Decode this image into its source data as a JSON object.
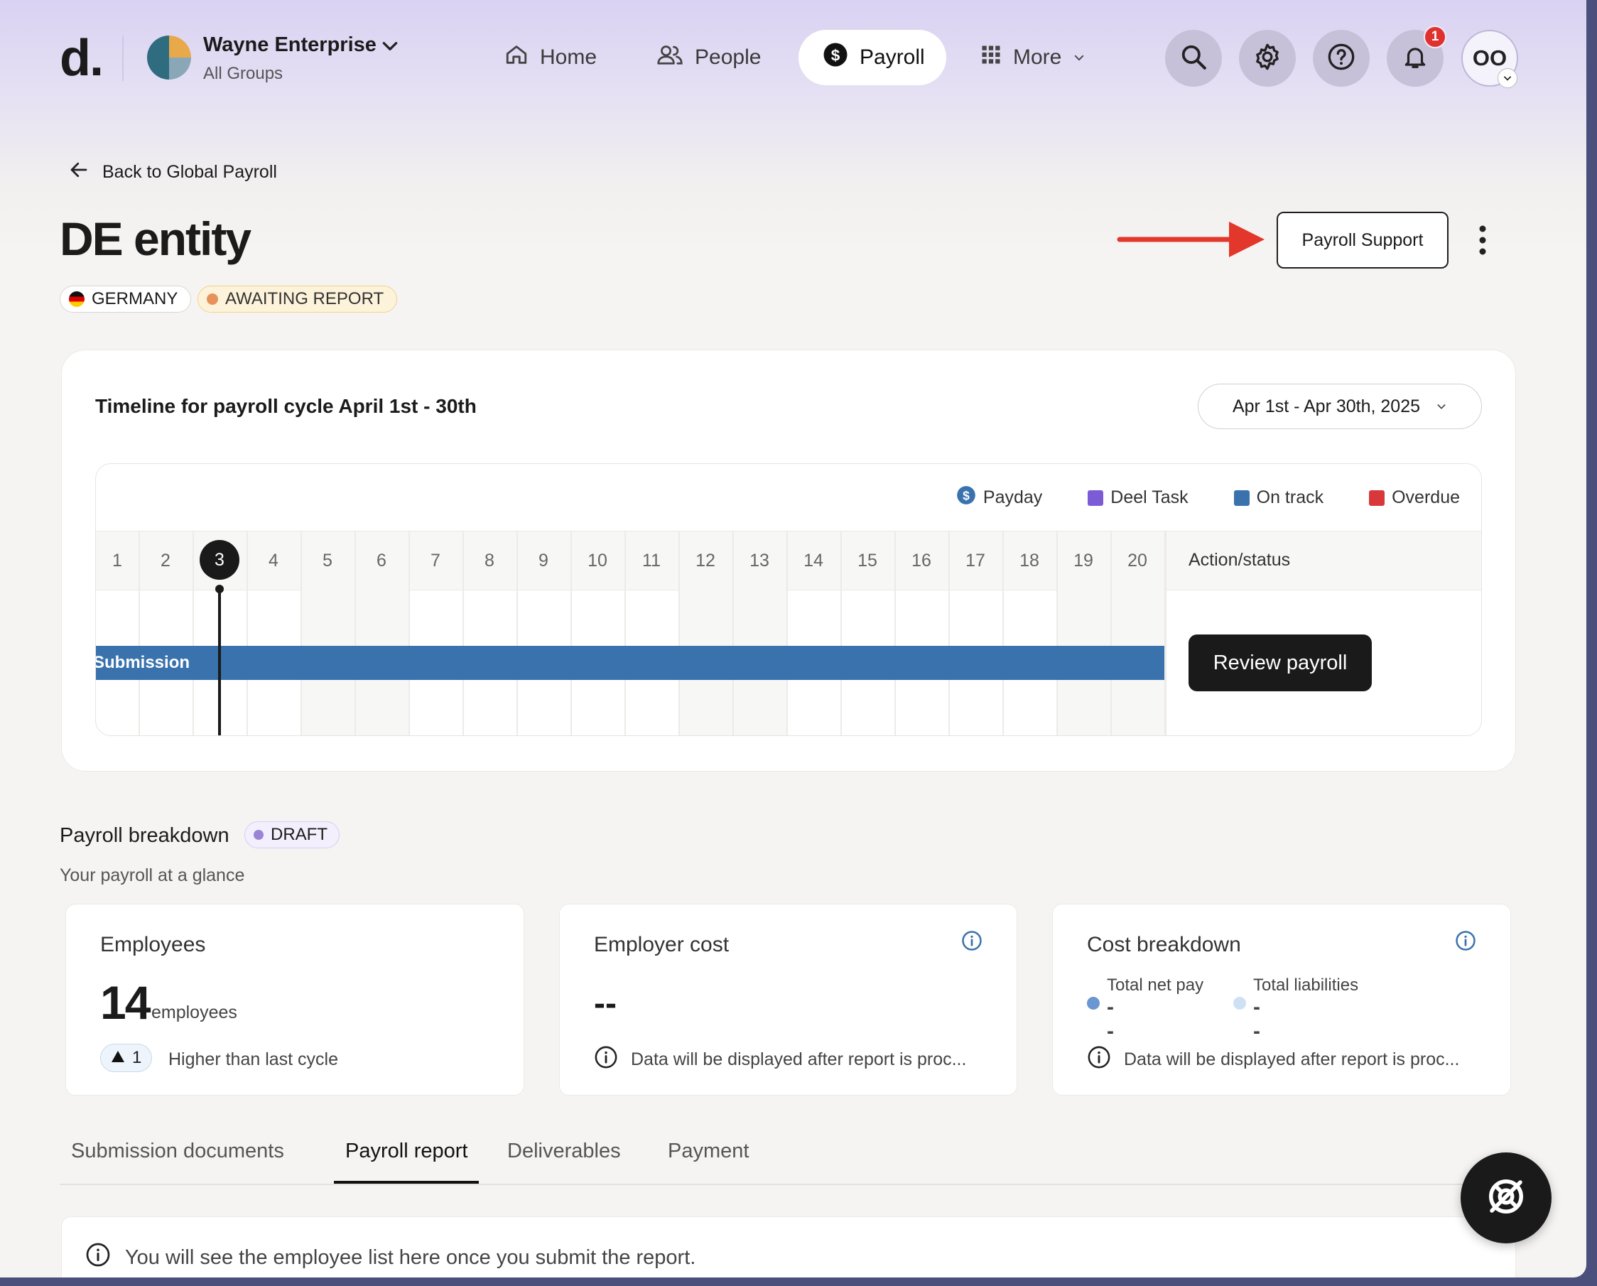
{
  "nav": {
    "logo": "d.",
    "org_name": "Wayne Enterprise",
    "org_group": "All Groups",
    "items": [
      {
        "label": "Home",
        "icon": "home-icon"
      },
      {
        "label": "People",
        "icon": "people-icon"
      },
      {
        "label": "Payroll",
        "icon": "dollar-icon",
        "active": true
      },
      {
        "label": "More",
        "icon": "grid-icon"
      }
    ],
    "notification_count": "1",
    "user_initials": "OO"
  },
  "header": {
    "back_label": "Back to Global Payroll",
    "title": "DE entity",
    "country_chip": "GERMANY",
    "status_chip": "AWAITING REPORT",
    "support_button": "Payroll Support"
  },
  "timeline": {
    "title": "Timeline for payroll cycle April 1st - 30th",
    "date_range": "Apr 1st - Apr 30th, 2025",
    "legend": [
      {
        "label": "Payday",
        "color": "#3a72ad"
      },
      {
        "label": "Deel Task",
        "color": "#7c5cd6"
      },
      {
        "label": "On track",
        "color": "#3a72ad"
      },
      {
        "label": "Overdue",
        "color": "#d9383a"
      }
    ],
    "days": [
      "1",
      "2",
      "3",
      "4",
      "5",
      "6",
      "7",
      "8",
      "9",
      "10",
      "11",
      "12",
      "13",
      "14",
      "15",
      "16",
      "17",
      "18",
      "19",
      "20"
    ],
    "today": "3",
    "action_header": "Action/status",
    "bar_label": "Submission",
    "bar_color": "#3a72ad",
    "review_button": "Review payroll"
  },
  "breakdown": {
    "title": "Payroll breakdown",
    "status": "DRAFT",
    "subtitle": "Your payroll at a glance",
    "employees": {
      "title": "Employees",
      "count": "14",
      "unit": "employees",
      "delta": "1",
      "delta_text": "Higher than last cycle"
    },
    "employer_cost": {
      "title": "Employer cost",
      "value": "--",
      "note": "Data will be displayed after report is proc..."
    },
    "cost_breakdown": {
      "title": "Cost breakdown",
      "net_pay_label": "Total net pay",
      "net_pay_value": "--",
      "liabilities_label": "Total liabilities",
      "liabilities_value": "--",
      "note": "Data will be displayed after report is proc..."
    }
  },
  "tabs": [
    {
      "label": "Submission documents",
      "active": false
    },
    {
      "label": "Payroll report",
      "active": true
    },
    {
      "label": "Deliverables",
      "active": false
    },
    {
      "label": "Payment",
      "active": false
    }
  ],
  "empty_message": "You will see the employee list here once you submit the report."
}
